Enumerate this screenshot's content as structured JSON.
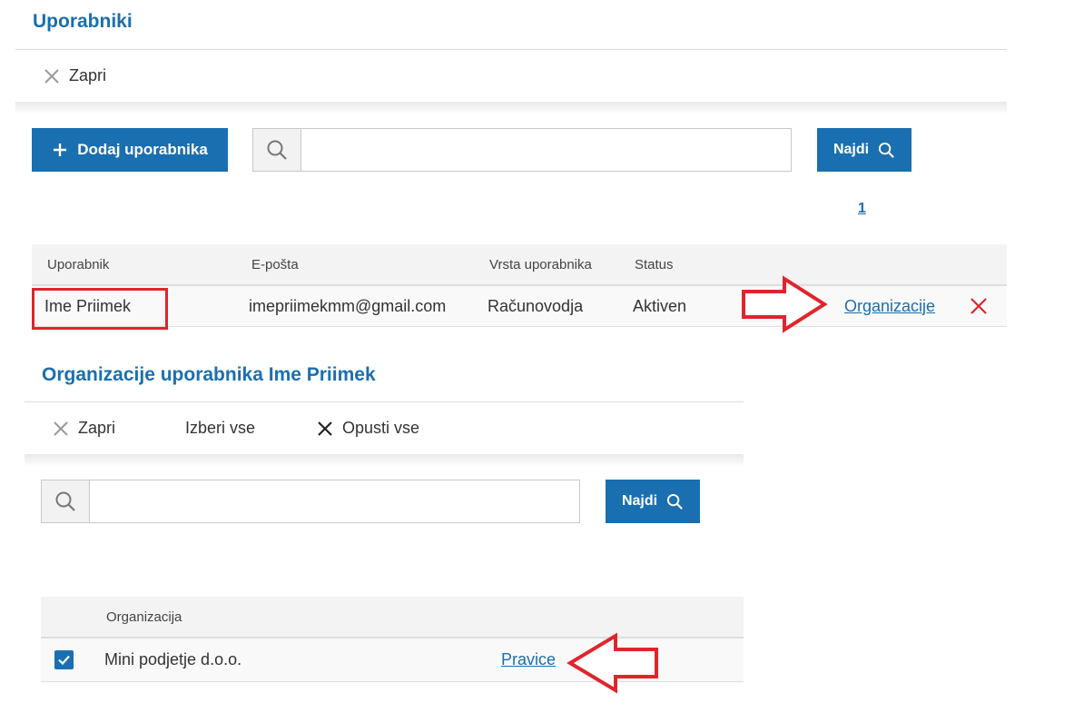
{
  "users_panel": {
    "title": "Uporabniki",
    "close_label": "Zapri",
    "add_button_label": "Dodaj uporabnika",
    "search": {
      "value": "",
      "placeholder": ""
    },
    "find_button_label": "Najdi",
    "pagination": {
      "current_page": "1"
    },
    "table": {
      "headers": [
        "Uporabnik",
        "E-pošta",
        "Vrsta uporabnika",
        "Status"
      ],
      "rows": [
        {
          "user": "Ime Priimek",
          "email": "imepriimekmm@gmail.com",
          "type": "Računovodja",
          "status": "Aktiven",
          "link_label": "Organizacije"
        }
      ]
    }
  },
  "orgs_panel": {
    "title": "Organizacije uporabnika Ime Priimek",
    "close_label": "Zapri",
    "select_all_label": "Izberi vse",
    "deselect_all_label": "Opusti vse",
    "search": {
      "value": "",
      "placeholder": ""
    },
    "find_button_label": "Najdi",
    "table": {
      "headers": [
        "Organizacija"
      ],
      "rows": [
        {
          "checked": true,
          "organization": "Mini podjetje d.o.o.",
          "link_label": "Pravice"
        }
      ]
    }
  },
  "colors": {
    "accent": "#1a6fb0",
    "annotation_red": "#e0242c",
    "delete_red": "#e0242c"
  },
  "icons": [
    "close-icon",
    "plus-icon",
    "search-icon",
    "delete-icon",
    "checkmark-icon",
    "arrow-right-annotation",
    "arrow-left-annotation"
  ]
}
